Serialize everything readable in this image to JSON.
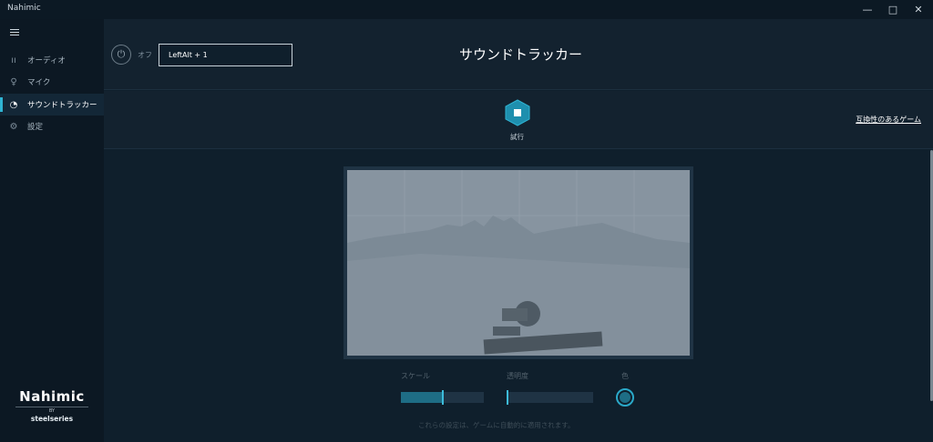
{
  "window": {
    "title": "Nahimic",
    "minimize": "—",
    "maximize": "□",
    "close": "✕"
  },
  "sidebar": {
    "items": [
      {
        "label": "オーディオ",
        "icon": "audio-icon"
      },
      {
        "label": "マイク",
        "icon": "mic-icon"
      },
      {
        "label": "サウンドトラッカー",
        "icon": "sound-tracker-icon",
        "active": true
      },
      {
        "label": "設定",
        "icon": "gear-icon"
      }
    ],
    "logo": {
      "main": "Nahimic",
      "by": "BY",
      "brand": "steelseries"
    }
  },
  "header": {
    "power_label": "オフ",
    "hotkey_value": "LeftAlt + 1",
    "title": "サウンドトラッカー"
  },
  "toolbar": {
    "try_label": "試行",
    "compat_link": "互換性のあるゲーム"
  },
  "controls": {
    "scale_label": "スケール",
    "scale_value": 0.5,
    "opacity_label": "透明度",
    "opacity_value": 0.0,
    "color_label": "色",
    "color_value": "#1e6d85",
    "footnote": "これらの設定は、ゲームに自動的に適用されます。"
  },
  "colors": {
    "accent": "#2fb4d3",
    "background": "#0f1f2c"
  }
}
